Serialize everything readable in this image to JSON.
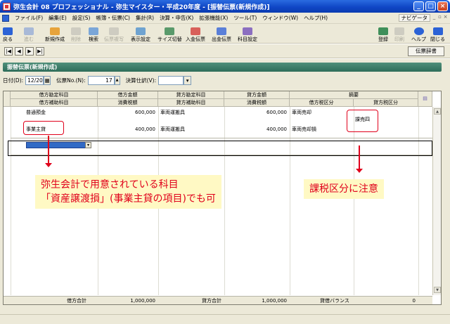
{
  "window": {
    "title": "弥生会計 08 プロフェッショナル - 弥生マイスター・平成20年度 - [振替伝票(新規作成)]"
  },
  "menu": {
    "items": [
      "ファイル(F)",
      "編集(E)",
      "設定(S)",
      "帳簿・伝票(C)",
      "集計(R)",
      "決算・申告(K)",
      "拡張機能(X)",
      "ツール(T)",
      "ウィンドウ(W)",
      "ヘルプ(H)"
    ],
    "navi": "ナビゲータ"
  },
  "toolbar": {
    "back": "戻る",
    "forward": "進む",
    "new": "新規作成",
    "delete": "削除",
    "search": "検索",
    "duplicate": "伝票複写",
    "display_settings": "表示設定",
    "size_switch": "サイズ切替",
    "income_slip": "入金伝票",
    "payment_slip": "出金伝票",
    "account_settings": "科目設定",
    "register": "登録",
    "print": "印刷",
    "help": "ヘルプ",
    "close": "閉じる"
  },
  "slip_dictionary": "伝票辞書",
  "panel": {
    "title": "振替伝票(新規作成)"
  },
  "form": {
    "date_label": "日付(D):",
    "date_value": "12/20",
    "slip_no_label": "伝票No.(N):",
    "slip_no_value": "17",
    "settlement_label": "決算仕訳(V):",
    "settlement_value": ""
  },
  "grid": {
    "headers_top": [
      "借方勘定科目",
      "借方金額",
      "貸方勘定科目",
      "貸方金額",
      "摘要"
    ],
    "headers_bottom": [
      "借方補助科目",
      "消費税額",
      "貸方補助科目",
      "消費税額",
      "借方税区分",
      "貸方税区分"
    ],
    "rows": [
      {
        "debit_account": "普通預金",
        "debit_amount": "600,000",
        "credit_account": "車両運搬具",
        "credit_amount": "600,000",
        "summary": "車両売却",
        "credit_tax": ""
      },
      {
        "debit_account": "",
        "debit_amount": "",
        "credit_account": "",
        "credit_amount": "",
        "summary": "",
        "credit_tax": "課売四"
      },
      {
        "debit_account": "事業主貸",
        "debit_amount": "400,000",
        "credit_account": "車両運搬具",
        "credit_amount": "400,000",
        "summary": "車両売却損",
        "credit_tax": ""
      }
    ],
    "footer": {
      "debit_total_label": "借方合計",
      "debit_total": "1,000,000",
      "credit_total_label": "貸方合計",
      "credit_total": "1,000,000",
      "balance_label": "貸借バランス",
      "balance": "0"
    }
  },
  "annotations": {
    "left_line1": "弥生会計で用意されている科目",
    "left_line2": "「資産譲渡損」(事業主貸の項目)でも可",
    "right": "課税区分に注意",
    "color": "#e0001b"
  }
}
